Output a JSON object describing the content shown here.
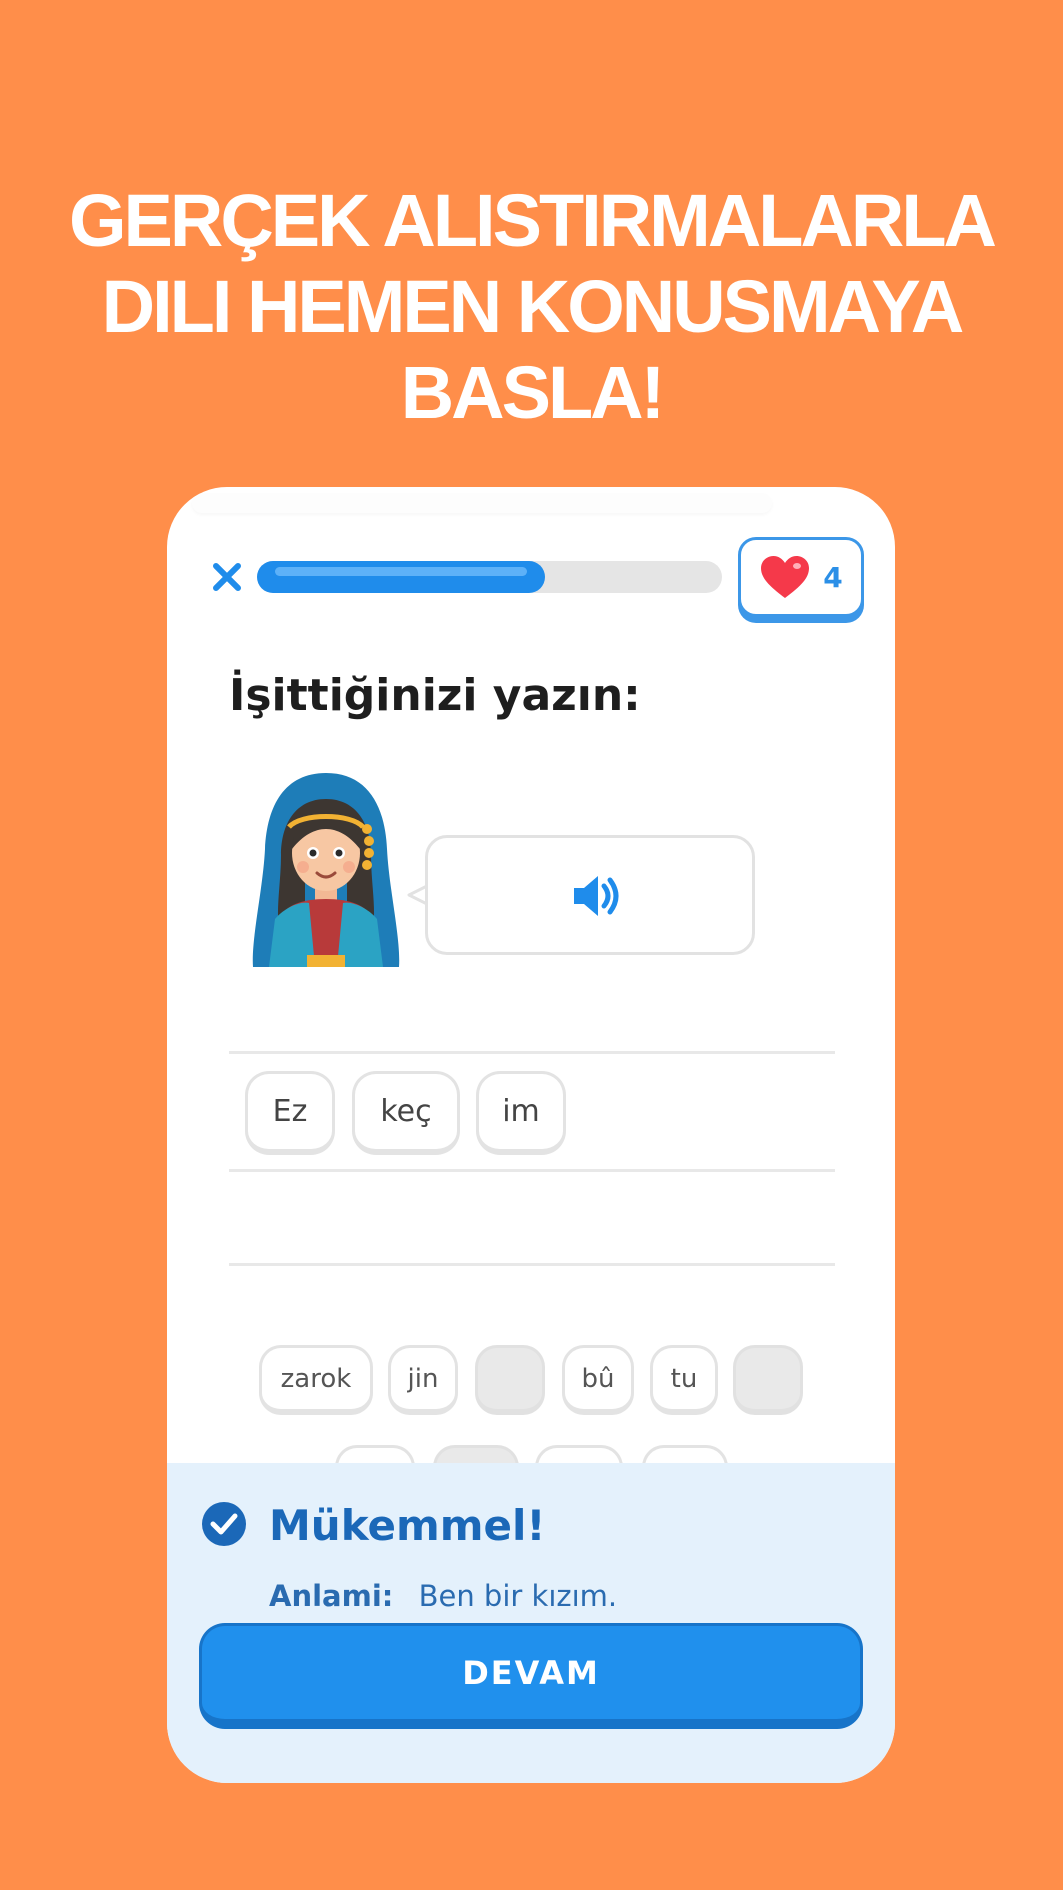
{
  "headline": {
    "line1": "GERÇEK ALISTIRMALARLA",
    "line2": "DILI HEMEN KONUSMAYA",
    "line3": "BASLA!"
  },
  "lesson": {
    "close_icon": "close-icon",
    "progress_fraction": 0.62,
    "hearts_icon": "heart-icon",
    "hearts_count": "4",
    "prompt": "İşittiğinizi yazın:",
    "audio_icon": "speaker-icon"
  },
  "answer": {
    "chips": [
      "Ez",
      "keç",
      "im"
    ]
  },
  "word_bank": {
    "row1": [
      "zarok",
      "jin",
      "",
      "bû",
      "tu",
      ""
    ]
  },
  "feedback": {
    "icon": "check-circle-icon",
    "title": "Mükemmel!",
    "meaning_label": "Anlami:",
    "meaning_text": "Ben bir kızım.",
    "continue_label": "DEVAM"
  },
  "colors": {
    "background": "#FF8E4A",
    "accent_blue": "#2090ED",
    "heart_red": "#F5394A",
    "feedback_bg": "#E4F1FC"
  }
}
